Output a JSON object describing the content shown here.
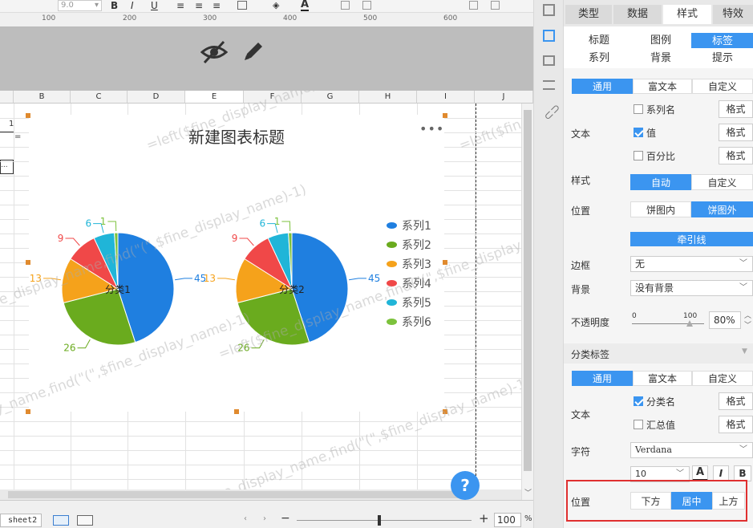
{
  "toolbar": {
    "font_size": "9.0",
    "bold": "B",
    "italic": "I",
    "underline": "U",
    "font_color": "A"
  },
  "ruler": {
    "marks": [
      "100",
      "200",
      "300",
      "400",
      "500",
      "600"
    ]
  },
  "columns": [
    "B",
    "C",
    "D",
    "E",
    "F",
    "G",
    "H",
    "I",
    "J"
  ],
  "cells": {
    "r1": "1",
    "r2": "=",
    "r3": "..."
  },
  "chart_data": {
    "type": "pie",
    "title": "新建图表标题",
    "pies": [
      {
        "category": "分类1",
        "labels": [
          "45",
          "26",
          "13",
          "9",
          "6",
          "1"
        ]
      },
      {
        "category": "分类2",
        "labels": [
          "45",
          "26",
          "13",
          "9",
          "6",
          "1"
        ]
      }
    ],
    "series": [
      {
        "name": "系列1",
        "value": 45,
        "color": "#1f7fe0"
      },
      {
        "name": "系列2",
        "value": 26,
        "color": "#6aab1e"
      },
      {
        "name": "系列3",
        "value": 13,
        "color": "#f5a21b"
      },
      {
        "name": "系列4",
        "value": 9,
        "color": "#f04848"
      },
      {
        "name": "系列5",
        "value": 6,
        "color": "#20b5d8"
      },
      {
        "name": "系列6",
        "value": 1,
        "color": "#7cc23c"
      }
    ],
    "legend_position": "right"
  },
  "watermark": "=left($fine_display_name,find(\"(\",$fine_display_name)-1)",
  "bottom": {
    "sheet_tab": "sheet2",
    "zoom": "100",
    "zoom_unit": "%",
    "minus": "−",
    "plus": "+"
  },
  "help_label": "?",
  "panel": {
    "tabs": [
      "类型",
      "数据",
      "样式",
      "特效"
    ],
    "subtabs_row1": [
      "标题",
      "图例",
      "标签"
    ],
    "subtabs_row2": [
      "系列",
      "背景",
      "提示"
    ],
    "mode_tabs": [
      "通用",
      "富文本",
      "自定义"
    ],
    "text_label": "文本",
    "check_series_name": "系列名",
    "check_value": "值",
    "check_percent": "百分比",
    "format_btn": "格式",
    "style_label": "样式",
    "style_auto": "自动",
    "style_custom": "自定义",
    "position_label": "位置",
    "pos_inside": "饼图内",
    "pos_outside": "饼图外",
    "leader_line": "牵引线",
    "border_label": "边框",
    "border_value": "无",
    "background_label": "背景",
    "background_value": "没有背景",
    "opacity_label": "不透明度",
    "opacity_min": "0",
    "opacity_max": "100",
    "opacity_value": "80%",
    "category_label_section": "分类标签",
    "mode_tabs2": [
      "通用",
      "富文本",
      "自定义"
    ],
    "text_label2": "文本",
    "check_category_name": "分类名",
    "check_total": "汇总值",
    "font_label": "字符",
    "font_value": "Verdana",
    "font_size_value": "10",
    "position_label2": "位置",
    "pos_below": "下方",
    "pos_center": "居中",
    "pos_above": "上方"
  }
}
